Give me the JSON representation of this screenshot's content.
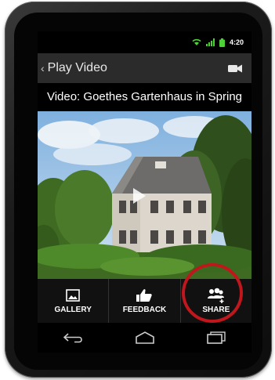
{
  "status_bar": {
    "time": "4:20"
  },
  "action_bar": {
    "title": "Play Video",
    "back_icon": "chevron-left-icon",
    "camera_icon": "video-camera-icon"
  },
  "video": {
    "title": "Video: Goethes Gartenhaus in Spring"
  },
  "bottom_actions": [
    {
      "label": "GALLERY",
      "icon": "image-icon"
    },
    {
      "label": "FEEDBACK",
      "icon": "thumbs-up-icon"
    },
    {
      "label": "SHARE",
      "icon": "share-people-icon"
    }
  ],
  "nav": {
    "back": "back-icon",
    "home": "home-icon",
    "recents": "recents-icon"
  },
  "colors": {
    "highlight": "#c0171d",
    "action_bar": "#2b2b2b",
    "status_green": "#4cd137"
  }
}
